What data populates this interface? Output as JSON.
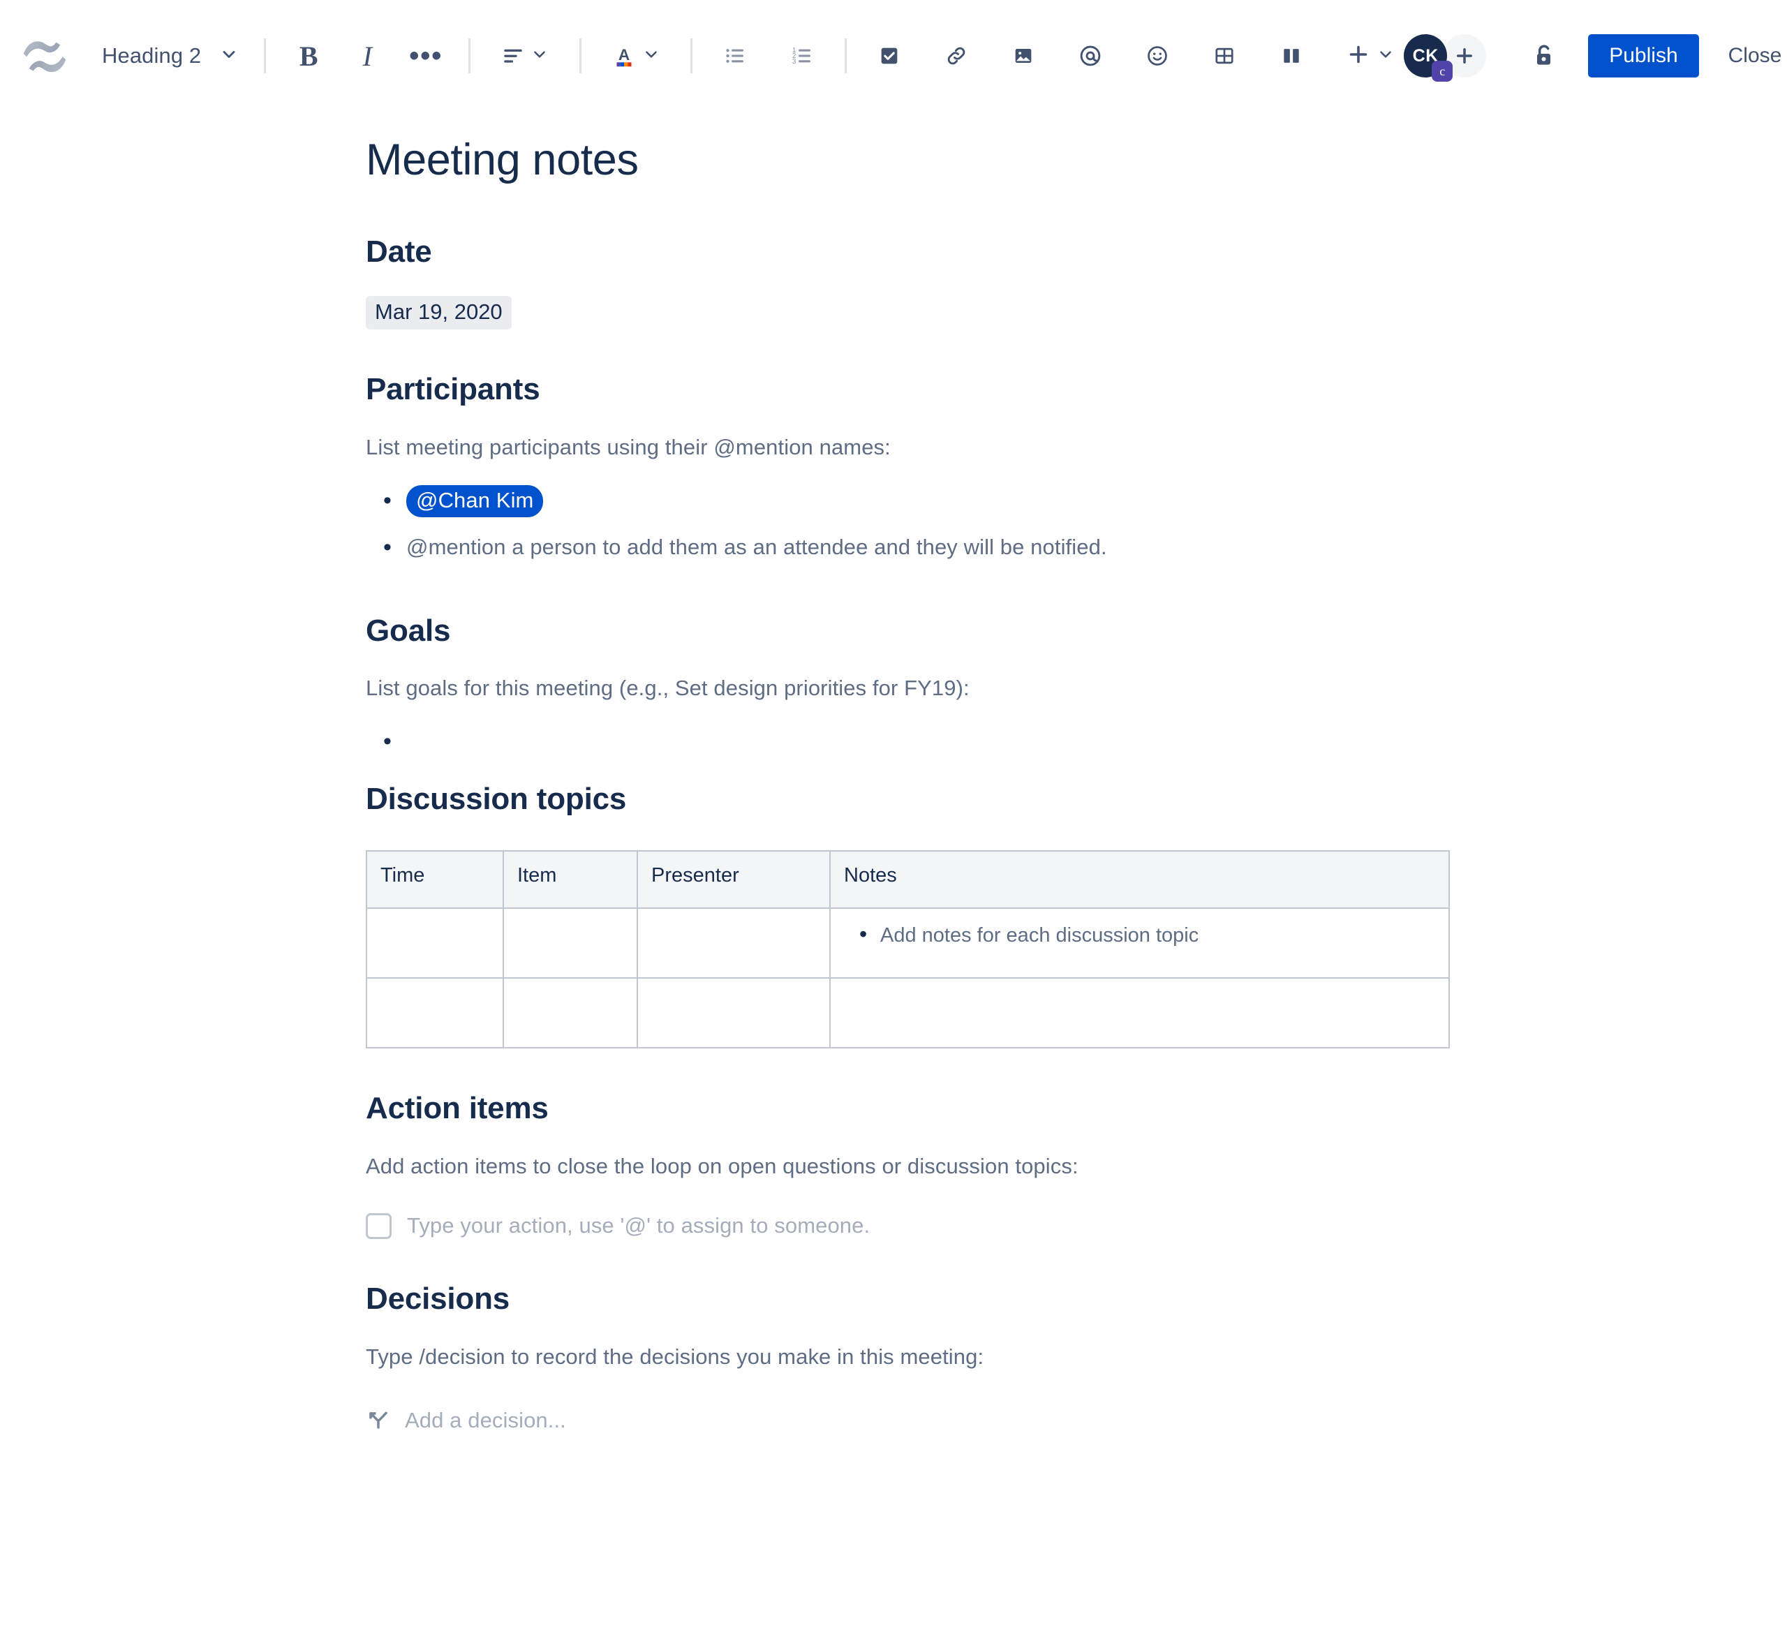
{
  "toolbar": {
    "logo_icon": "confluence-logo-icon",
    "block_type": {
      "label": "Heading 2",
      "chevron_icon": "chevron-down-icon"
    },
    "format_group": {
      "bold_label": "B",
      "italic_label": "I",
      "more_formatting_label": "•••",
      "bold_icon": "bold-icon",
      "italic_icon": "italic-icon",
      "more_formatting_icon": "ellipsis-icon"
    },
    "align_group": {
      "align_icon": "text-align-left-icon",
      "chevron_icon": "chevron-down-icon"
    },
    "color_group": {
      "color_icon": "text-color-icon",
      "chevron_icon": "chevron-down-icon"
    },
    "list_group": {
      "bullet_icon": "bullet-list-icon",
      "numbered_icon": "numbered-list-icon"
    },
    "insert_group": {
      "task_icon": "action-checkbox-icon",
      "link_icon": "link-icon",
      "image_icon": "image-icon",
      "mention_icon": "mention-at-icon",
      "emoji_icon": "emoji-smiley-icon",
      "table_icon": "table-icon",
      "layout_icon": "page-layout-icon",
      "plus_icon": "plus-icon",
      "plus_chevron_icon": "chevron-down-icon"
    },
    "avatar": {
      "initials": "CK",
      "badge_letter": "c",
      "badge_color": "#5243aa",
      "bg_color": "#172b4d"
    },
    "add_people_icon": "add-person-plus-icon",
    "restrictions_icon": "unlock-icon",
    "publish_label": "Publish",
    "publish_color": "#0052cc",
    "close_label": "Close",
    "more_options_icon": "ellipsis-icon",
    "more_options_label": "•••"
  },
  "document": {
    "title": "Meeting notes",
    "sections": {
      "date": {
        "heading": "Date",
        "value": "Mar 19, 2020"
      },
      "participants": {
        "heading": "Participants",
        "intro": "List meeting participants using their @mention names:",
        "mention": "@Chan Kim",
        "hint": "@mention a person to add them as an attendee and they will be notified."
      },
      "goals": {
        "heading": "Goals",
        "intro": "List goals for this meeting (e.g., Set design priorities for FY19):",
        "empty_item": ""
      },
      "discussion": {
        "heading": "Discussion topics",
        "columns": [
          "Time",
          "Item",
          "Presenter",
          "Notes"
        ],
        "rows": [
          {
            "time": "",
            "item": "",
            "presenter": "",
            "notes": "Add notes for each discussion topic"
          },
          {
            "time": "",
            "item": "",
            "presenter": "",
            "notes": ""
          }
        ]
      },
      "action_items": {
        "heading": "Action items",
        "intro": "Add action items to close the loop on open questions or discussion topics:",
        "placeholder": "Type your action, use '@' to assign to someone.",
        "checkbox_icon": "unchecked-checkbox-icon"
      },
      "decisions": {
        "heading": "Decisions",
        "intro": "Type /decision to record the decisions you make in this meeting:",
        "placeholder": "Add a decision...",
        "decision_icon": "decision-branch-icon"
      }
    }
  }
}
